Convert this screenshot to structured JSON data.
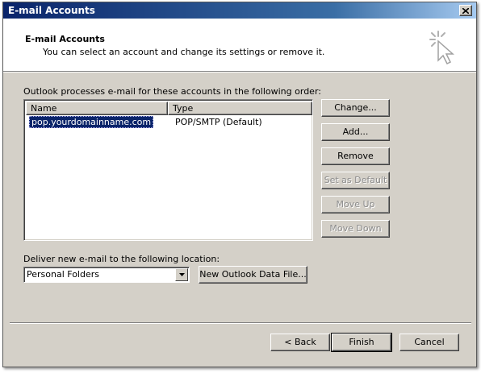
{
  "window": {
    "title": "E-mail Accounts"
  },
  "header": {
    "title": "E-mail Accounts",
    "subtitle": "You can select an account and change its settings or remove it."
  },
  "accounts": {
    "label": "Outlook processes e-mail for these accounts in the following order:",
    "columns": [
      "Name",
      "Type"
    ],
    "rows": [
      {
        "name": "pop.yourdomainname.com",
        "type": "POP/SMTP (Default)"
      }
    ]
  },
  "side_buttons": {
    "change": "Change...",
    "add": "Add...",
    "remove": "Remove",
    "set_default": "Set as Default",
    "move_up": "Move Up",
    "move_down": "Move Down"
  },
  "deliver": {
    "label": "Deliver new e-mail to the following location:",
    "selected": "Personal Folders",
    "new_file_button": "New Outlook Data File..."
  },
  "footer": {
    "back": "< Back",
    "finish": "Finish",
    "cancel": "Cancel"
  }
}
